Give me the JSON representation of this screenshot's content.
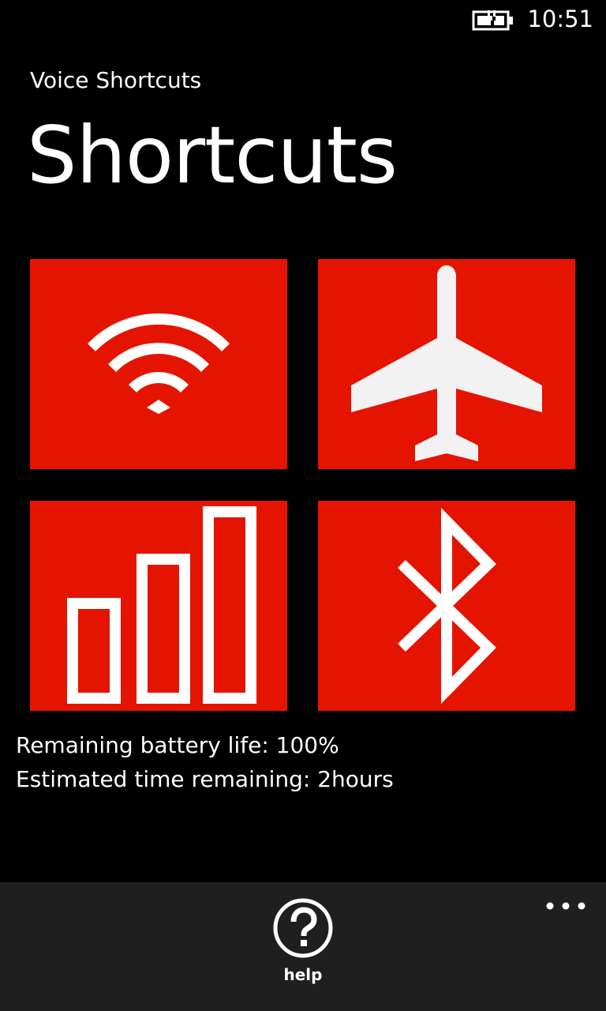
{
  "status_bar": {
    "time": "10:51",
    "battery_icon": "battery-charging-icon"
  },
  "header": {
    "app_name": "Voice Shortcuts",
    "page_title": "Shortcuts"
  },
  "tiles": [
    {
      "name": "wifi",
      "icon": "wifi-icon"
    },
    {
      "name": "airplane-mode",
      "icon": "airplane-icon"
    },
    {
      "name": "cellular",
      "icon": "signal-bars-icon"
    },
    {
      "name": "bluetooth",
      "icon": "bluetooth-icon"
    }
  ],
  "info": {
    "battery_life": "Remaining battery life: 100%",
    "time_remaining": "Estimated time remaining: 2hours"
  },
  "app_bar": {
    "help_label": "help",
    "help_icon": "help-icon",
    "more_icon": "more-icon"
  },
  "colors": {
    "accent": "#e51400",
    "background": "#000000",
    "app_bar": "#1f1f1f",
    "foreground": "#ffffff"
  }
}
